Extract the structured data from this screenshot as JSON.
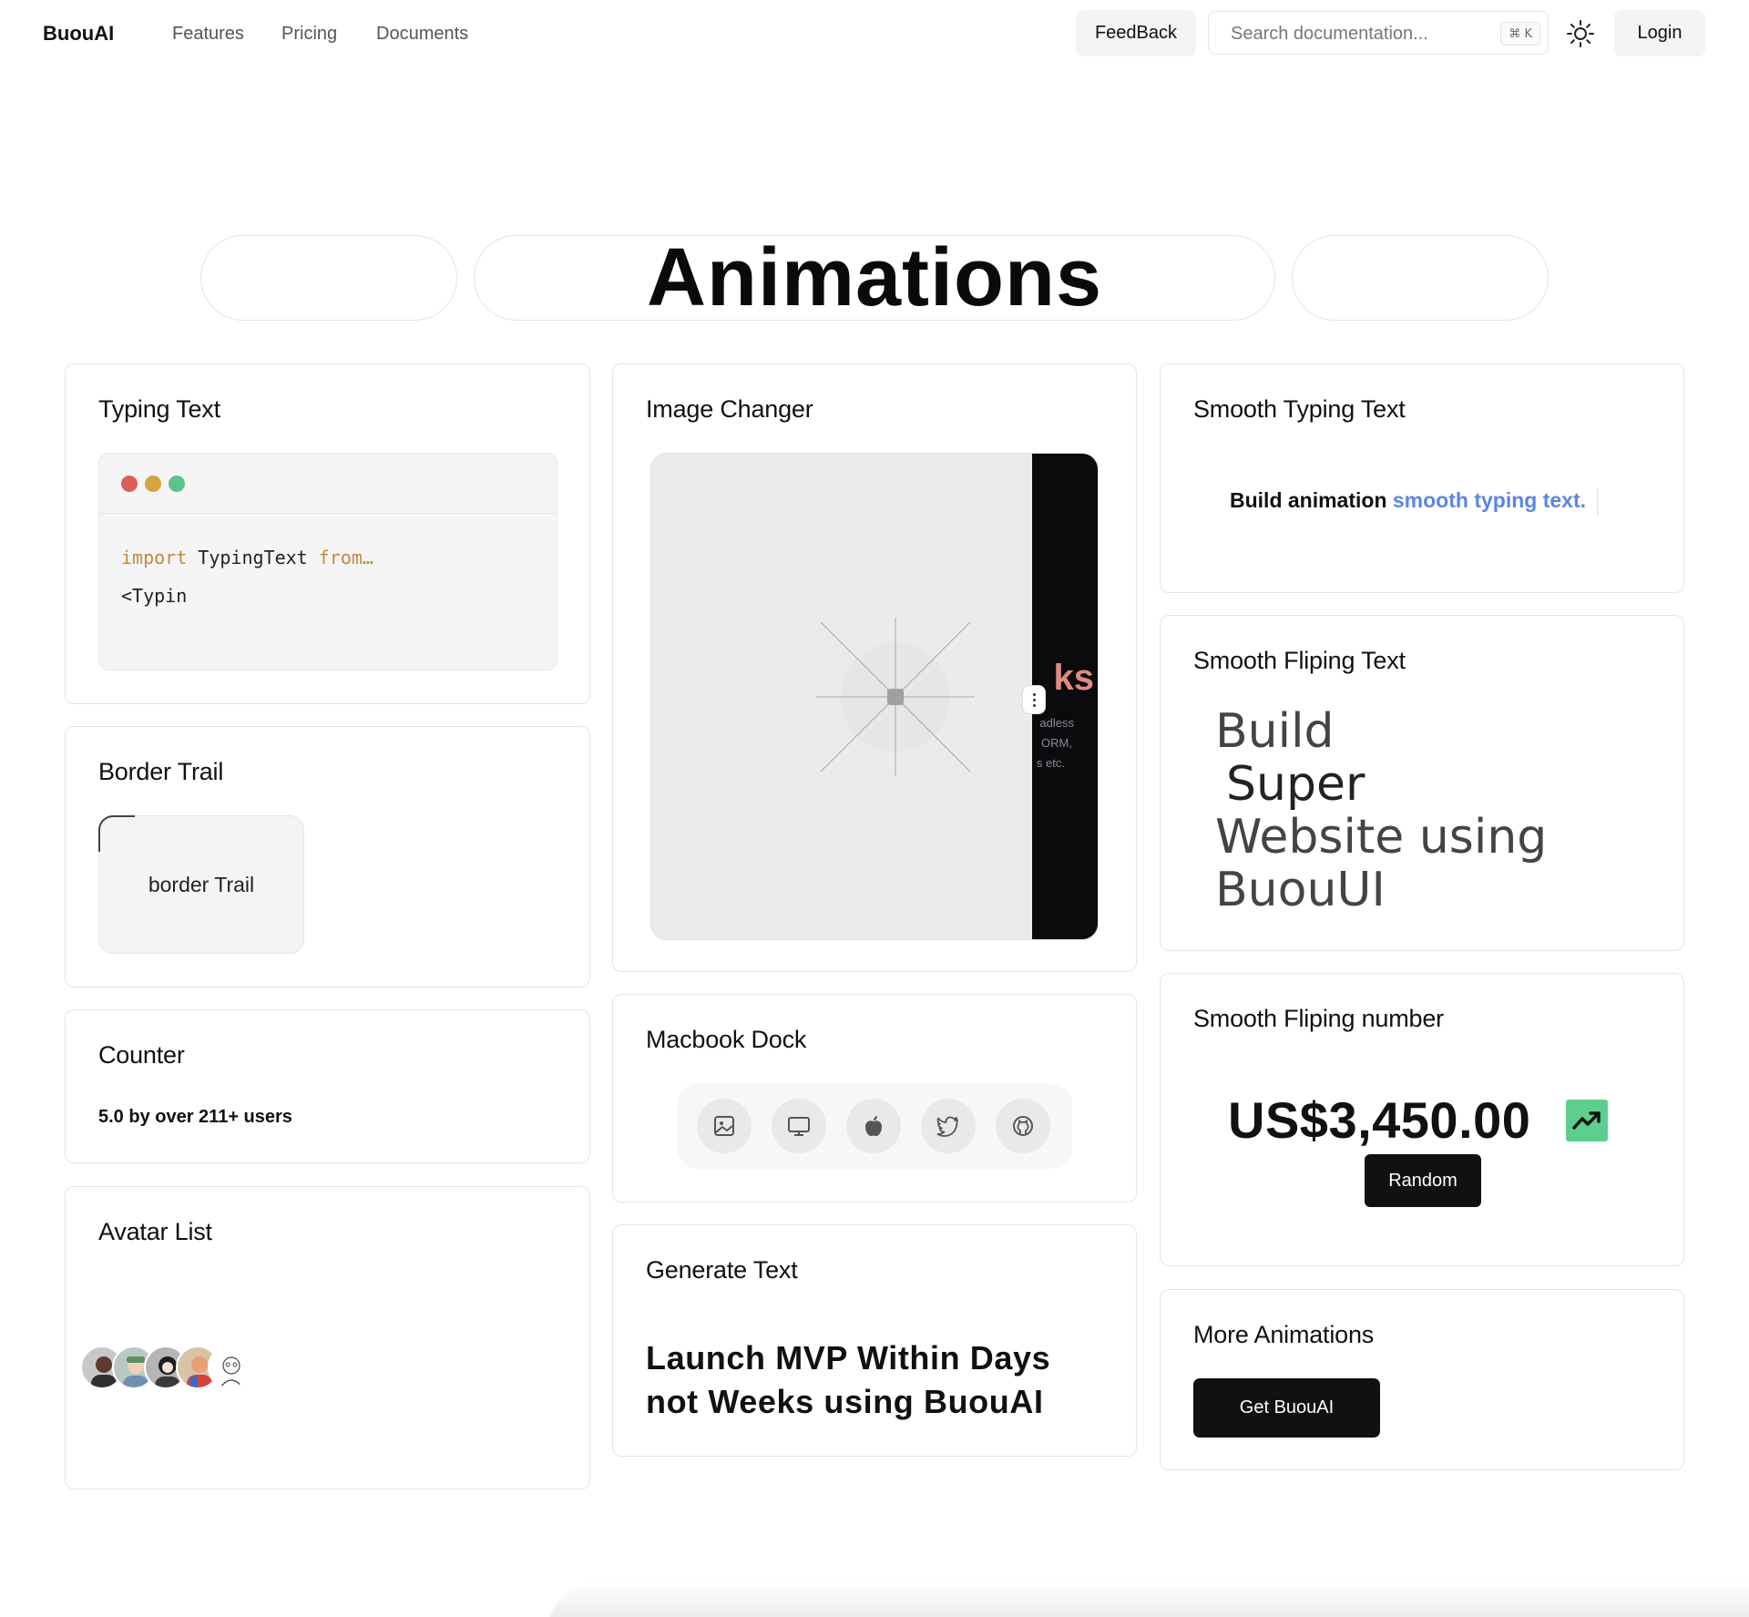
{
  "nav": {
    "logo": "BuouAI",
    "links": [
      "Features",
      "Pricing",
      "Documents"
    ],
    "feedback_label": "FeedBack",
    "search_placeholder": "Search documentation...",
    "search_shortcut": "⌘ K",
    "login_label": "Login"
  },
  "hero": {
    "title": "Animations"
  },
  "typing_text": {
    "title": "Typing Text",
    "code_kw1": "import",
    "code_mid": " TypingText ",
    "code_kw2": "from…",
    "code_line2": "<Typin",
    "dot_colors": [
      "#d9605a",
      "#d6a440",
      "#5cc38a"
    ]
  },
  "border_trail": {
    "title": "Border Trail",
    "box_label": "border Trail"
  },
  "counter": {
    "title": "Counter",
    "text": "5.0 by over 211+ users"
  },
  "avatar_list": {
    "title": "Avatar List"
  },
  "image_changer": {
    "title": "Image Changer",
    "dark_word": "ks",
    "dark_lines": [
      "adless",
      "ORM,",
      "s etc."
    ]
  },
  "macbook_dock": {
    "title": "Macbook Dock",
    "icons": [
      "image-icon",
      "monitor-icon",
      "apple-icon",
      "twitter-icon",
      "github-icon"
    ]
  },
  "generate_text": {
    "title": "Generate Text",
    "line1": "Launch MVP Within Days",
    "line2": "not Weeks using BuouAI"
  },
  "smooth_typing": {
    "title": "Smooth Typing Text",
    "text_plain": "Build animation ",
    "text_accent": "smooth typing text.",
    "accent_color": "#5b86e5"
  },
  "smooth_flipping_text": {
    "title": "Smooth Fliping Text",
    "lines": [
      "Build",
      "Super",
      "Website using",
      "BuouUI"
    ]
  },
  "smooth_flipping_number": {
    "title": "Smooth Fliping number",
    "value": "US$3,450.00",
    "button_label": "Random",
    "trend_color": "#5ccf8f"
  },
  "more_animations": {
    "title": "More Animations",
    "button_label": "Get BuouAI"
  }
}
